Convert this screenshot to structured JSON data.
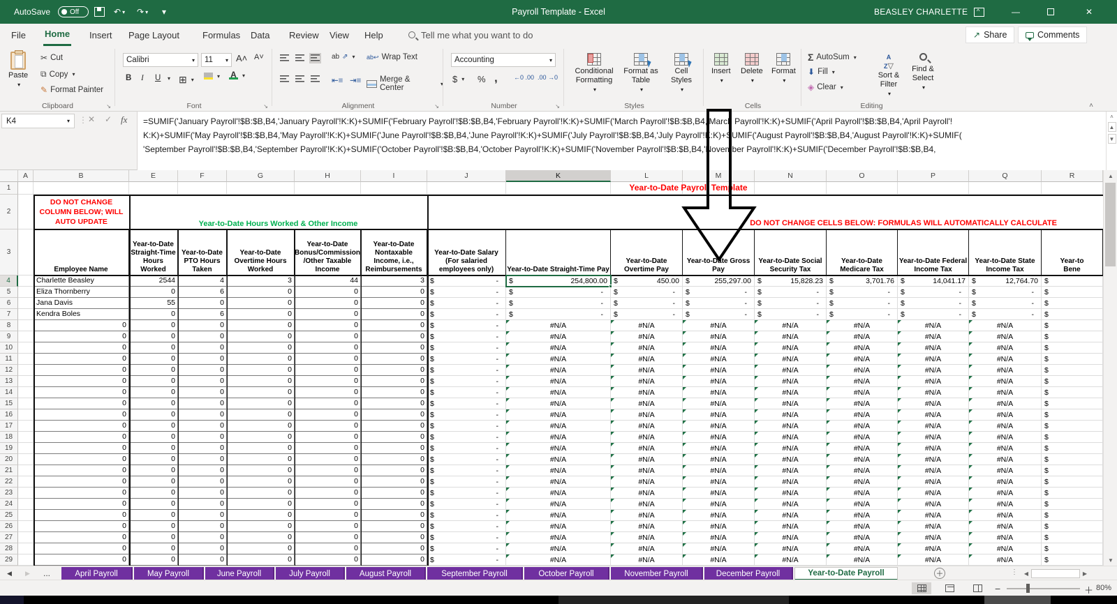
{
  "title_bar": {
    "autosave_label": "AutoSave",
    "autosave_state": "Off",
    "title": "Payroll Template - Excel",
    "user": "BEASLEY CHARLETTE"
  },
  "menu": {
    "tabs": [
      "File",
      "Home",
      "Insert",
      "Page Layout",
      "Formulas",
      "Data",
      "Review",
      "View",
      "Help"
    ],
    "active_tab": "Home",
    "search_placeholder": "Tell me what you want to do",
    "share_label": "Share",
    "comments_label": "Comments"
  },
  "ribbon": {
    "clipboard": {
      "paste": "Paste",
      "cut": "Cut",
      "copy": "Copy",
      "format_painter": "Format Painter",
      "label": "Clipboard"
    },
    "font": {
      "family": "Calibri",
      "size": "11",
      "bold": "B",
      "italic": "I",
      "underline": "U",
      "label": "Font"
    },
    "alignment": {
      "wrap": "Wrap Text",
      "merge": "Merge & Center",
      "label": "Alignment"
    },
    "number": {
      "format": "Accounting",
      "currency": "$",
      "percent": "%",
      "comma": ",",
      "inc_dec": "←0 .00",
      "dec_dec": ".00 →0",
      "label": "Number"
    },
    "styles": {
      "conditional": "Conditional Formatting",
      "format_table": "Format as Table",
      "cell_styles": "Cell Styles",
      "label": "Styles"
    },
    "cells": {
      "insert": "Insert",
      "delete": "Delete",
      "format": "Format",
      "label": "Cells"
    },
    "editing": {
      "autosum": "AutoSum",
      "fill": "Fill",
      "clear": "Clear",
      "sort": "Sort & Filter",
      "find": "Find & Select",
      "label": "Editing"
    }
  },
  "formula_bar": {
    "cell_ref": "K4",
    "fx": "fx",
    "line1": "=SUMIF('January Payroll'!$B:$B,B4,'January Payroll'!K:K)+SUMIF('February Payroll'!$B:$B,B4,'February Payroll'!K:K)+SUMIF('March Payroll'!$B:$B,B4,'March Payroll'!K:K)+SUMIF('April Payroll'!$B:$B,B4,'April Payroll'!",
    "line2": "K:K)+SUMIF('May Payroll'!$B:$B,B4,'May Payroll'!K:K)+SUMIF('June Payroll'!$B:$B,B4,'June Payroll'!K:K)+SUMIF('July Payroll'!$B:$B,B4,'July Payroll'!K:K)+SUMIF('August Payroll'!$B:$B,B4,'August Payroll'!K:K)+SUMIF(",
    "line3": "'September Payroll'!$B:$B,B4,'September Payroll'!K:K)+SUMIF('October Payroll'!$B:$B,B4,'October Payroll'!K:K)+SUMIF('November Payroll'!$B:$B,B4,'November Payroll'!K:K)+SUMIF('December Payroll'!$B:$B,B4,"
  },
  "grid": {
    "col_letters": [
      "A",
      "B",
      "E",
      "F",
      "G",
      "H",
      "I",
      "J",
      "K",
      "L",
      "M",
      "N",
      "O",
      "P",
      "Q",
      "R"
    ],
    "selected_col": "K",
    "selected_row": 4,
    "selected_cell": "K4",
    "row1_title": "Year-to-Date Payroll Template",
    "b2_note": "DO NOT CHANGE\nCOLUMN BELOW; WILL\nAUTO UPDATE",
    "hours_banner": "Year-to-Date Hours Worked & Other Income",
    "calc_banner": "DO NOT CHANGE CELLS BELOW: FORMULAS WILL AUTOMATICALLY CALCULATE",
    "headers": {
      "B": "Employee Name",
      "E": "Year-to-Date Straight-Time Hours Worked",
      "F": "Year-to-Date PTO Hours Taken",
      "G": "Year-to-Date Overtime Hours Worked",
      "H": "Year-to-Date Bonus/Commission /Other Taxable Income",
      "I": "Year-to-Date Nontaxable Income, i.e., Reimbursements",
      "J": "Year-to-Date Salary (For salaried employees only)",
      "K": "Year-to-Date Straight-Time Pay",
      "L": "Year-to-Date Overtime Pay",
      "M": "Year-to-Date Gross Pay",
      "N": "Year-to-Date Social Security Tax",
      "O": "Year-to-Date Medicare Tax",
      "P": "Year-to-Date Federal Income Tax",
      "Q": "Year-to-Date State Income Tax",
      "R": "Year-to\nBene"
    },
    "employees": [
      {
        "B": "Charlette Beasley",
        "E": "2544",
        "F": "4",
        "G": "3",
        "H": "44",
        "I": "3",
        "J": "-",
        "K": "254,800.00",
        "L": "450.00",
        "M": "255,297.00",
        "N": "15,828.23",
        "O": "3,701.76",
        "P": "14,041.17",
        "Q": "12,764.70",
        "R": "$"
      },
      {
        "B": "Eliza Thornberry",
        "E": "0",
        "F": "6",
        "G": "0",
        "H": "0",
        "I": "0",
        "J": "-",
        "K": "-",
        "L": "-",
        "M": "-",
        "N": "-",
        "O": "-",
        "P": "-",
        "Q": "-",
        "R": "$"
      },
      {
        "B": "Jana Davis",
        "E": "55",
        "F": "0",
        "G": "0",
        "H": "0",
        "I": "0",
        "J": "-",
        "K": "-",
        "L": "-",
        "M": "-",
        "N": "-",
        "O": "-",
        "P": "-",
        "Q": "-",
        "R": "$"
      },
      {
        "B": "Kendra Boles",
        "E": "0",
        "F": "6",
        "G": "0",
        "H": "0",
        "I": "0",
        "J": "-",
        "K": "-",
        "L": "-",
        "M": "-",
        "N": "-",
        "O": "-",
        "P": "-",
        "Q": "-",
        "R": "$"
      }
    ],
    "filler_row": {
      "B": "0",
      "E": "0",
      "F": "0",
      "G": "0",
      "H": "0",
      "I": "0",
      "J": "-",
      "na": "#N/A",
      "R": "$"
    },
    "filler_rows_from": 8,
    "filler_rows_to": 29,
    "dollar": "$",
    "dash": "-",
    "na_text": "#N/A"
  },
  "sheet_tabs": {
    "tabs": [
      "April Payroll",
      "May Payroll",
      "June Payroll",
      "July Payroll",
      "August Payroll",
      "September Payroll",
      "October Payroll",
      "November Payroll",
      "December Payroll"
    ],
    "active": "Year-to-Date Payroll",
    "more_indicator": "..."
  },
  "status_bar": {
    "zoom_level": "80%"
  },
  "colors": {
    "excel_green": "#1f6b43",
    "banner_green": "#00b050",
    "warning_red": "#fe0000",
    "tab_purple": "#7030a0",
    "error_flag_green": "#1f7145"
  }
}
